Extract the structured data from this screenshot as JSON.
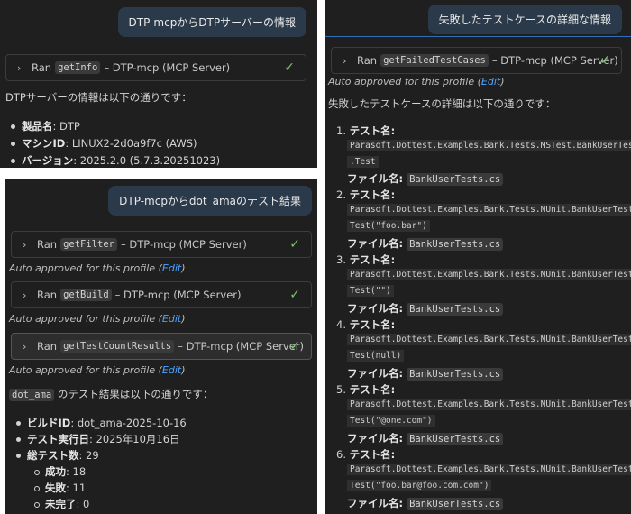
{
  "panel1": {
    "bubble": "DTP-mcpからDTPサーバーの情報",
    "tool": {
      "ran": "Ran",
      "code": "getInfo",
      "server": "– DTP-mcp (MCP Server)"
    },
    "intro": "DTPサーバーの情報は以下の通りです：",
    "items": [
      {
        "label": "製品名",
        "value": ": DTP"
      },
      {
        "label": "マシンID",
        "value": ": LINUX2-2d0a9f7c (AWS)"
      },
      {
        "label": "バージョン",
        "value": ": 2025.2.0 (5.7.3.20251023)"
      }
    ]
  },
  "panel2": {
    "bubble": "DTP-mcpからdot_amaのテスト結果",
    "tools": [
      {
        "ran": "Ran",
        "code": "getFilter",
        "server": "– DTP-mcp (MCP Server)"
      },
      {
        "ran": "Ran",
        "code": "getBuild",
        "server": "– DTP-mcp (MCP Server)"
      },
      {
        "ran": "Ran",
        "code": "getTestCountResults",
        "server": "– DTP-mcp (MCP Server)"
      }
    ],
    "approved": "Auto approved for this profile (",
    "edit": "Edit",
    "approved_end": ")",
    "intro_code": "dot_ama",
    "intro": " のテスト結果は以下の通りです：",
    "items": [
      {
        "label": "ビルドID",
        "value": ": dot_ama-2025-10-16"
      },
      {
        "label": "テスト実行日",
        "value": ": 2025年10月16日"
      },
      {
        "label": "総テスト数",
        "value": ": 29"
      }
    ],
    "subitems": [
      {
        "label": "成功",
        "value": ": 18"
      },
      {
        "label": "失敗",
        "value": ": 11"
      },
      {
        "label": "未完了",
        "value": ": 0"
      }
    ]
  },
  "panel3": {
    "bubble": "失敗したテストケースの詳細な情報",
    "tool": {
      "ran": "Ran",
      "code": "getFailedTestCases",
      "server": "– DTP-mcp (MCP Server)"
    },
    "approved": "Auto approved for this profile (",
    "edit": "Edit",
    "approved_end": ")",
    "intro": "失敗したテストケースの詳細は以下の通りです：",
    "test_label": "テスト名",
    "file_label": "ファイル名",
    "cases": [
      {
        "n": "1.",
        "line1": "Parasoft.Dottest.Examples.Bank.Tests.MSTest.BankUserTests",
        "line2": ".Test",
        "file": "BankUserTests.cs"
      },
      {
        "n": "2.",
        "line1": "Parasoft.Dottest.Examples.Bank.Tests.NUnit.BankUserTests.",
        "line2": "Test(\"foo.bar\")",
        "file": "BankUserTests.cs"
      },
      {
        "n": "3.",
        "line1": "Parasoft.Dottest.Examples.Bank.Tests.NUnit.BankUserTests.",
        "line2": "Test(\"\")",
        "file": "BankUserTests.cs"
      },
      {
        "n": "4.",
        "line1": "Parasoft.Dottest.Examples.Bank.Tests.NUnit.BankUserTests.",
        "line2": "Test(null)",
        "file": "BankUserTests.cs"
      },
      {
        "n": "5.",
        "line1": "Parasoft.Dottest.Examples.Bank.Tests.NUnit.BankUserTests.",
        "line2": "Test(\"@one.com\")",
        "file": "BankUserTests.cs"
      },
      {
        "n": "6.",
        "line1": "Parasoft.Dottest.Examples.Bank.Tests.NUnit.BankUserTests.",
        "line2": "Test(\"foo.bar@foo.com.com\")",
        "file": "BankUserTests.cs"
      }
    ]
  }
}
